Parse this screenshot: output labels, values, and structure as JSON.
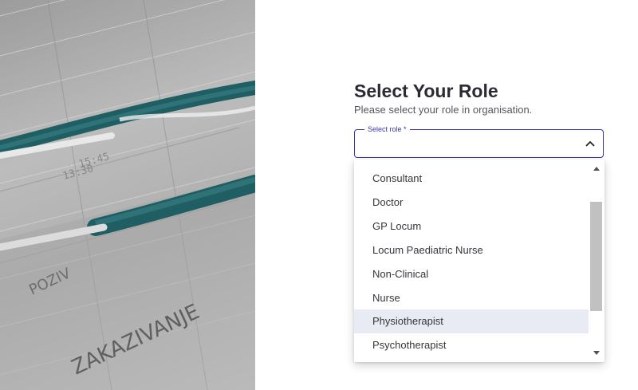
{
  "page": {
    "title": "Select Your Role",
    "subtitle": "Please select your role in organisation."
  },
  "role_select": {
    "label": "Select role *",
    "value": "",
    "expanded": true,
    "options": [
      "Consultant",
      "Doctor",
      "GP Locum",
      "Locum Paediatric Nurse",
      "Non-Clinical",
      "Nurse",
      "Physiotherapist",
      "Psychotherapist"
    ],
    "highlighted": "Physiotherapist"
  },
  "icons": {
    "field_chevron": "chevron-up-icon",
    "scroll_up": "scroll-up-arrow-icon",
    "scroll_down": "scroll-down-arrow-icon"
  },
  "colors": {
    "accent": "#3a35a8",
    "highlight": "#e9ebf4",
    "title": "#2b2b33"
  },
  "photo": {
    "description_icon": "stethoscope-on-paperwork-image"
  }
}
